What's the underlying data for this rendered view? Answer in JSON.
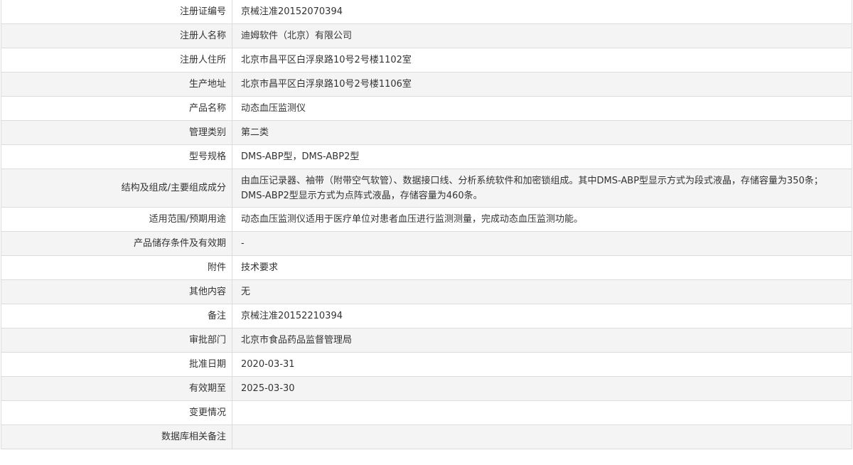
{
  "rows": [
    {
      "label": "注册证编号",
      "value": "京械注准20152070394"
    },
    {
      "label": "注册人名称",
      "value": "迪姆软件（北京）有限公司"
    },
    {
      "label": "注册人住所",
      "value": "北京市昌平区白浮泉路10号2号楼1102室"
    },
    {
      "label": "生产地址",
      "value": "北京市昌平区白浮泉路10号2号楼1106室"
    },
    {
      "label": "产品名称",
      "value": "动态血压监测仪"
    },
    {
      "label": "管理类别",
      "value": "第二类"
    },
    {
      "label": "型号规格",
      "value": "DMS-ABP型，DMS-ABP2型"
    },
    {
      "label": "结构及组成/主要组成成分",
      "value": "由血压记录器、袖带（附带空气软管）、数据接口线、分析系统软件和加密锁组成。其中DMS-ABP型显示方式为段式液晶，存储容量为350条；DMS-ABP2型显示方式为点阵式液晶，存储容量为460条。"
    },
    {
      "label": "适用范围/预期用途",
      "value": "动态血压监测仪适用于医疗单位对患者血压进行监测测量，完成动态血压监测功能。"
    },
    {
      "label": "产品储存条件及有效期",
      "value": "-"
    },
    {
      "label": "附件",
      "value": "技术要求"
    },
    {
      "label": "其他内容",
      "value": "无"
    },
    {
      "label": "备注",
      "value": "京械注准20152210394"
    },
    {
      "label": "审批部门",
      "value": "北京市食品药品监督管理局"
    },
    {
      "label": "批准日期",
      "value": "2020-03-31"
    },
    {
      "label": "有效期至",
      "value": "2025-03-30"
    },
    {
      "label": "变更情况",
      "value": ""
    },
    {
      "label": "数据库相关备注",
      "value": ""
    }
  ]
}
